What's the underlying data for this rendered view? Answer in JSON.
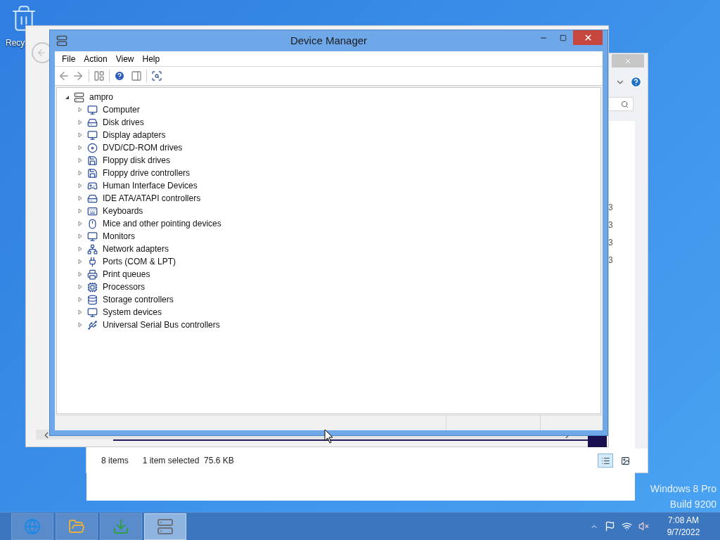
{
  "desktop": {
    "icons": [
      {
        "label": "Recy"
      }
    ],
    "edition_lines": [
      "Windows 8 Pro",
      "Build 9200"
    ]
  },
  "explorer_window_right": {
    "column_fragments": [
      "3",
      "3",
      "3",
      "3"
    ],
    "status_items": [
      "8 items",
      "1 item selected  75.6 KB"
    ],
    "views": [
      {
        "kind": "details",
        "selected": true
      },
      {
        "kind": "large",
        "selected": false
      }
    ]
  },
  "device_manager": {
    "title": "Device Manager",
    "menu": [
      "File",
      "Action",
      "View",
      "Help"
    ],
    "tree": {
      "label": "ampro",
      "expanded": true,
      "children": [
        {
          "label": "Computer",
          "kind": "computer",
          "expanded": false
        },
        {
          "label": "Disk drives",
          "kind": "disk",
          "expanded": false
        },
        {
          "label": "Display adapters",
          "kind": "display",
          "expanded": false
        },
        {
          "label": "DVD/CD-ROM drives",
          "kind": "dvd",
          "expanded": false
        },
        {
          "label": "Floppy disk drives",
          "kind": "floppy",
          "expanded": false
        },
        {
          "label": "Floppy drive controllers",
          "kind": "floppy",
          "expanded": false
        },
        {
          "label": "Human Interface Devices",
          "kind": "hid",
          "expanded": false
        },
        {
          "label": "IDE ATA/ATAPI controllers",
          "kind": "disk",
          "expanded": false
        },
        {
          "label": "Keyboards",
          "kind": "keyboard",
          "expanded": false
        },
        {
          "label": "Mice and other pointing devices",
          "kind": "mouse",
          "expanded": false
        },
        {
          "label": "Monitors",
          "kind": "computer",
          "expanded": false
        },
        {
          "label": "Network adapters",
          "kind": "network",
          "expanded": false
        },
        {
          "label": "Ports (COM & LPT)",
          "kind": "port",
          "expanded": false
        },
        {
          "label": "Print queues",
          "kind": "printer",
          "expanded": false
        },
        {
          "label": "Processors",
          "kind": "cpu",
          "expanded": false
        },
        {
          "label": "Storage controllers",
          "kind": "storage",
          "expanded": false
        },
        {
          "label": "System devices",
          "kind": "computer",
          "expanded": false
        },
        {
          "label": "Universal Serial Bus controllers",
          "kind": "usb",
          "expanded": false
        }
      ]
    }
  },
  "taskbar": {
    "buttons": [
      {
        "kind": "browser",
        "selected": false
      },
      {
        "kind": "folder",
        "selected": false
      },
      {
        "kind": "download",
        "selected": false
      },
      {
        "kind": "device-manager",
        "selected": true
      }
    ],
    "clock": {
      "time": "7:08 AM",
      "date": "9/7/2022"
    }
  }
}
